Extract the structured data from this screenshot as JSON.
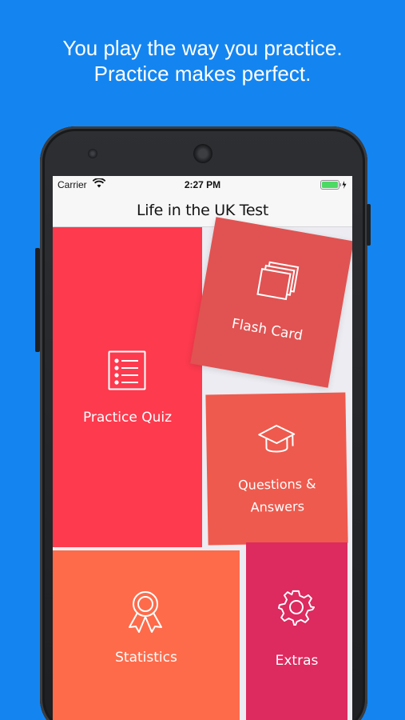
{
  "tagline": {
    "line1": "You play the way you practice.",
    "line2": "Practice makes perfect."
  },
  "status_bar": {
    "carrier": "Carrier",
    "time": "2:27 PM"
  },
  "nav": {
    "title": "Life in the UK Test"
  },
  "tiles": {
    "practice_quiz": {
      "label": "Practice Quiz",
      "icon": "list-icon",
      "color": "#fd3a4e"
    },
    "flash_card": {
      "label": "Flash Card",
      "icon": "cards-icon",
      "color": "#e05352"
    },
    "qa": {
      "label_line1": "Questions &",
      "label_line2": "Answers",
      "icon": "graduation-cap-icon",
      "color": "#ee5a4d"
    },
    "statistics": {
      "label": "Statistics",
      "icon": "award-ribbon-icon",
      "color": "#fe6b4a"
    },
    "extras": {
      "label": "Extras",
      "icon": "gear-icon",
      "color": "#dd2a5f"
    }
  },
  "colors": {
    "background": "#1485f0",
    "battery": "#4cd964"
  }
}
